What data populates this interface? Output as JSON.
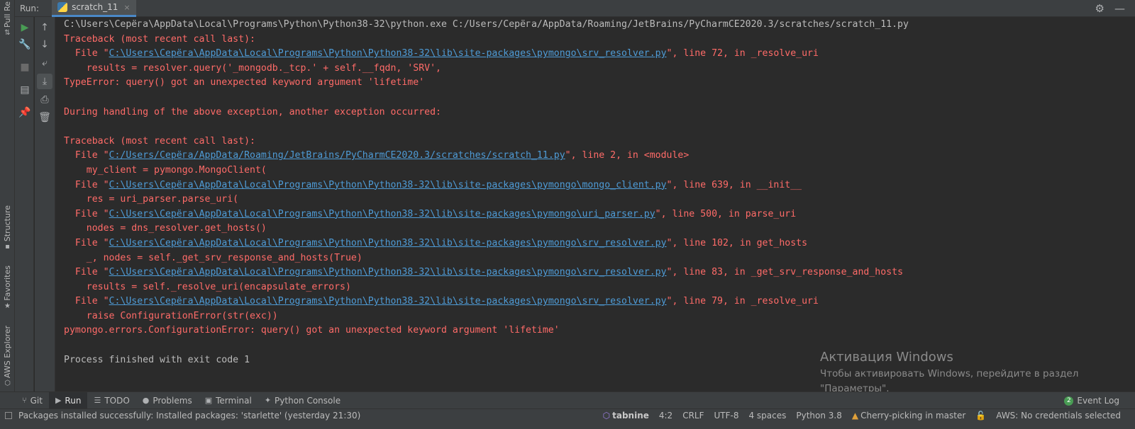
{
  "left_strip": {
    "pull_requests": "Pull Re",
    "structure": "Structure",
    "favorites": "Favorites",
    "aws_explorer": "AWS Explorer"
  },
  "run_panel": {
    "title": "Run:",
    "tab_label": "scratch_11",
    "tab_close": "×"
  },
  "console": {
    "lines": [
      {
        "kind": "plain",
        "parts": [
          {
            "t": "C:\\Users\\Серёга\\AppData\\Local\\Programs\\Python\\Python38-32\\python.exe C:/Users/Серёга/AppData/Roaming/JetBrains/PyCharmCE2020.3/scratches/scratch_11.py"
          }
        ]
      },
      {
        "kind": "err",
        "parts": [
          {
            "t": "Traceback (most recent call last):"
          }
        ]
      },
      {
        "kind": "err",
        "parts": [
          {
            "t": "  File \""
          },
          {
            "t": "C:\\Users\\Серёга\\AppData\\Local\\Programs\\Python\\Python38-32\\lib\\site-packages\\pymongo\\srv_resolver.py",
            "link": true
          },
          {
            "t": "\", line 72, in _resolve_uri"
          }
        ]
      },
      {
        "kind": "err",
        "parts": [
          {
            "t": "    results = resolver.query('_mongodb._tcp.' + self.__fqdn, 'SRV',"
          }
        ]
      },
      {
        "kind": "err",
        "parts": [
          {
            "t": "TypeError: query() got an unexpected keyword argument 'lifetime'"
          }
        ]
      },
      {
        "kind": "err",
        "parts": [
          {
            "t": ""
          }
        ]
      },
      {
        "kind": "err",
        "parts": [
          {
            "t": "During handling of the above exception, another exception occurred:"
          }
        ]
      },
      {
        "kind": "err",
        "parts": [
          {
            "t": ""
          }
        ]
      },
      {
        "kind": "err",
        "parts": [
          {
            "t": "Traceback (most recent call last):"
          }
        ]
      },
      {
        "kind": "err",
        "parts": [
          {
            "t": "  File \""
          },
          {
            "t": "C:/Users/Серёга/AppData/Roaming/JetBrains/PyCharmCE2020.3/scratches/scratch_11.py",
            "link": true
          },
          {
            "t": "\", line 2, in <module>"
          }
        ]
      },
      {
        "kind": "err",
        "parts": [
          {
            "t": "    my_client = pymongo.MongoClient("
          }
        ]
      },
      {
        "kind": "err",
        "parts": [
          {
            "t": "  File \""
          },
          {
            "t": "C:\\Users\\Серёга\\AppData\\Local\\Programs\\Python\\Python38-32\\lib\\site-packages\\pymongo\\mongo_client.py",
            "link": true
          },
          {
            "t": "\", line 639, in __init__"
          }
        ]
      },
      {
        "kind": "err",
        "parts": [
          {
            "t": "    res = uri_parser.parse_uri("
          }
        ]
      },
      {
        "kind": "err",
        "parts": [
          {
            "t": "  File \""
          },
          {
            "t": "C:\\Users\\Серёга\\AppData\\Local\\Programs\\Python\\Python38-32\\lib\\site-packages\\pymongo\\uri_parser.py",
            "link": true
          },
          {
            "t": "\", line 500, in parse_uri"
          }
        ]
      },
      {
        "kind": "err",
        "parts": [
          {
            "t": "    nodes = dns_resolver.get_hosts()"
          }
        ]
      },
      {
        "kind": "err",
        "parts": [
          {
            "t": "  File \""
          },
          {
            "t": "C:\\Users\\Серёга\\AppData\\Local\\Programs\\Python\\Python38-32\\lib\\site-packages\\pymongo\\srv_resolver.py",
            "link": true
          },
          {
            "t": "\", line 102, in get_hosts"
          }
        ]
      },
      {
        "kind": "err",
        "parts": [
          {
            "t": "    _, nodes = self._get_srv_response_and_hosts(True)"
          }
        ]
      },
      {
        "kind": "err",
        "parts": [
          {
            "t": "  File \""
          },
          {
            "t": "C:\\Users\\Серёга\\AppData\\Local\\Programs\\Python\\Python38-32\\lib\\site-packages\\pymongo\\srv_resolver.py",
            "link": true
          },
          {
            "t": "\", line 83, in _get_srv_response_and_hosts"
          }
        ]
      },
      {
        "kind": "err",
        "parts": [
          {
            "t": "    results = self._resolve_uri(encapsulate_errors)"
          }
        ]
      },
      {
        "kind": "err",
        "parts": [
          {
            "t": "  File \""
          },
          {
            "t": "C:\\Users\\Серёга\\AppData\\Local\\Programs\\Python\\Python38-32\\lib\\site-packages\\pymongo\\srv_resolver.py",
            "link": true
          },
          {
            "t": "\", line 79, in _resolve_uri"
          }
        ]
      },
      {
        "kind": "err",
        "parts": [
          {
            "t": "    raise ConfigurationError(str(exc))"
          }
        ]
      },
      {
        "kind": "err",
        "parts": [
          {
            "t": "pymongo.errors.ConfigurationError: query() got an unexpected keyword argument 'lifetime'"
          }
        ]
      },
      {
        "kind": "plain",
        "parts": [
          {
            "t": ""
          }
        ]
      },
      {
        "kind": "plain",
        "parts": [
          {
            "t": "Process finished with exit code 1"
          }
        ]
      }
    ]
  },
  "watermark": {
    "line1": "Активация Windows",
    "line2": "Чтобы активировать Windows, перейдите в раздел",
    "line3": "\"Параметры\"."
  },
  "bottom_tabs": {
    "git": "Git",
    "run": "Run",
    "todo": "TODO",
    "problems": "Problems",
    "terminal": "Terminal",
    "python_console": "Python Console",
    "event_log_count": "2",
    "event_log": "Event Log"
  },
  "status_bar": {
    "message": "Packages installed successfully: Installed packages: 'starlette' (yesterday 21:30)",
    "tabnine": "tabnine",
    "position": "4:2",
    "line_separator": "CRLF",
    "encoding": "UTF-8",
    "indent": "4 spaces",
    "interpreter": "Python 3.8",
    "vcs": "Cherry-picking in master",
    "aws": "AWS: No credentials selected"
  },
  "colors": {
    "error_text": "#ff6b68",
    "link_text": "#4e9bd6",
    "plain_text": "#bbbbbb",
    "console_bg": "#2b2b2b",
    "panel_bg": "#3c3f41",
    "accent": "#4a88c7",
    "run_green": "#499c54"
  }
}
